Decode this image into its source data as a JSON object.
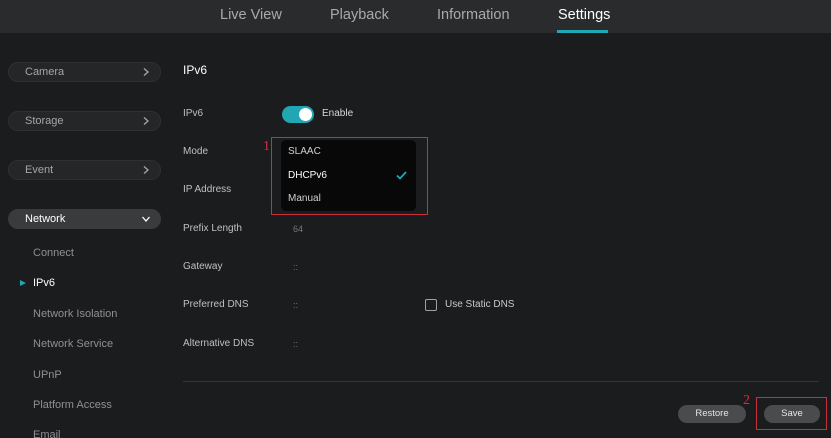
{
  "nav": {
    "tabs": [
      {
        "label": "Live View"
      },
      {
        "label": "Playback"
      },
      {
        "label": "Information"
      },
      {
        "label": "Settings"
      }
    ],
    "active": "Settings",
    "accent": "#21a6b4"
  },
  "sidebar": {
    "sections": [
      {
        "label": "Camera"
      },
      {
        "label": "Storage"
      },
      {
        "label": "Event"
      },
      {
        "label": "Network"
      }
    ],
    "network_items": [
      {
        "label": "Connect"
      },
      {
        "label": "IPv6"
      },
      {
        "label": "Network Isolation"
      },
      {
        "label": "Network Service"
      },
      {
        "label": "UPnP"
      },
      {
        "label": "Platform Access"
      },
      {
        "label": "Email"
      }
    ],
    "active_item": "IPv6"
  },
  "form": {
    "title": "IPv6",
    "ipv6": {
      "label": "IPv6",
      "toggle_label": "Enable",
      "enabled": true
    },
    "mode": {
      "label": "Mode",
      "options": [
        "SLAAC",
        "DHCPv6",
        "Manual"
      ],
      "selected": "DHCPv6"
    },
    "ip_address": {
      "label": "IP Address"
    },
    "prefix_length": {
      "label": "Prefix Length",
      "value": "64"
    },
    "gateway": {
      "label": "Gateway",
      "value": "::"
    },
    "preferred_dns": {
      "label": "Preferred DNS",
      "value": "::"
    },
    "use_static_dns": {
      "label": "Use Static DNS",
      "checked": false
    },
    "alternative_dns": {
      "label": "Alternative DNS",
      "value": "::"
    }
  },
  "actions": {
    "restore": "Restore",
    "save": "Save"
  },
  "annotations": {
    "step1": "1",
    "step2": "2",
    "color": "#c8303a"
  }
}
